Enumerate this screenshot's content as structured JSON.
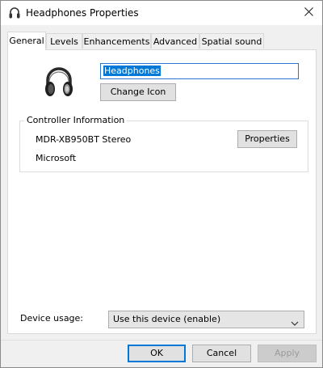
{
  "window": {
    "title": "Headphones Properties",
    "title_icon": "headphones-icon",
    "close_icon": "close-icon"
  },
  "tabs": [
    {
      "label": "General",
      "active": true
    },
    {
      "label": "Levels",
      "active": false
    },
    {
      "label": "Enhancements",
      "active": false
    },
    {
      "label": "Advanced",
      "active": false
    },
    {
      "label": "Spatial sound",
      "active": false
    }
  ],
  "general": {
    "device_icon": "headphones-icon",
    "device_name": "Headphones",
    "change_icon_label": "Change Icon",
    "controller": {
      "legend": "Controller Information",
      "name": "MDR-XB950BT Stereo",
      "manufacturer": "Microsoft",
      "properties_label": "Properties"
    },
    "device_usage": {
      "label": "Device usage:",
      "selected": "Use this device (enable)",
      "dropdown_icon": "chevron-down-icon"
    }
  },
  "footer": {
    "ok_label": "OK",
    "cancel_label": "Cancel",
    "apply_label": "Apply"
  },
  "colors": {
    "accent": "#0078d7",
    "window_bg": "#f0f0f0",
    "panel_bg": "#ffffff"
  }
}
